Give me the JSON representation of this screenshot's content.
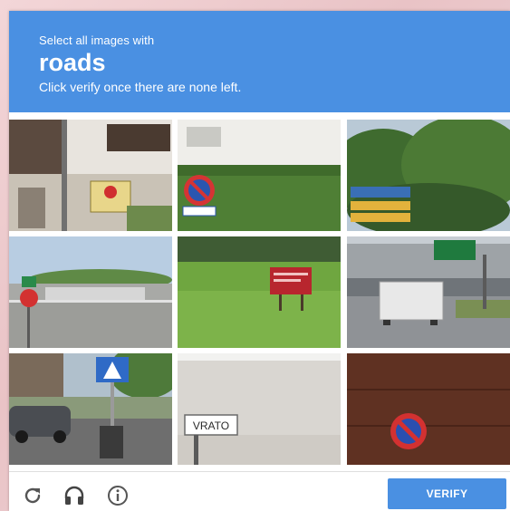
{
  "challenge": {
    "instruction_prefix": "Select all images with",
    "target": "roads",
    "instruction_suffix": "Click verify once there are none left.",
    "header_color": "#4a90e2"
  },
  "tiles": [
    {
      "description": "building with stop sign",
      "sign_text": ""
    },
    {
      "description": "hedge with no-parking sign",
      "sign_text": ""
    },
    {
      "description": "trees with direction signs",
      "sign_text": ""
    },
    {
      "description": "road with stop sign and parking lot",
      "sign_text": ""
    },
    {
      "description": "grass field with red sign",
      "sign_text": ""
    },
    {
      "description": "highway underpass with truck",
      "sign_text": ""
    },
    {
      "description": "street with pedestrian crossing sign and parked car",
      "sign_text": ""
    },
    {
      "description": "wall with town name sign",
      "sign_text": "VRATO"
    },
    {
      "description": "wooden wall with no-parking sign",
      "sign_text": ""
    }
  ],
  "footer": {
    "reload_icon": "reload-icon",
    "audio_icon": "headphones-icon",
    "info_icon": "info-icon",
    "verify_label": "VERIFY"
  }
}
